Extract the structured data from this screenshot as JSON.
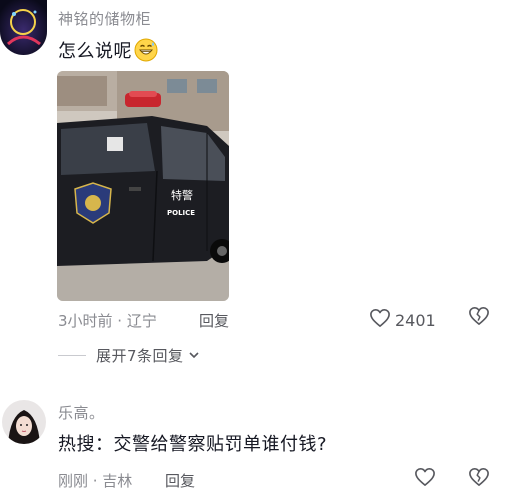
{
  "comment1": {
    "username": "神铭的储物柜",
    "text": "怎么说呢",
    "emoji": "grinning-sweat-emoji",
    "photo_label": "特警",
    "photo_sublabel": "POLICE",
    "meta": "3小时前 · 辽宁",
    "reply_label": "回复",
    "like_count": "2401"
  },
  "expand_replies": {
    "label": "展开7条回复"
  },
  "comment2": {
    "username": "乐高。",
    "text": "热搜：交警给警察贴罚单谁付钱?",
    "meta": "刚刚 · 吉林",
    "reply_label": "回复"
  },
  "colors": {
    "meta_gray": "#8a8b91",
    "text_dark": "#161823"
  }
}
